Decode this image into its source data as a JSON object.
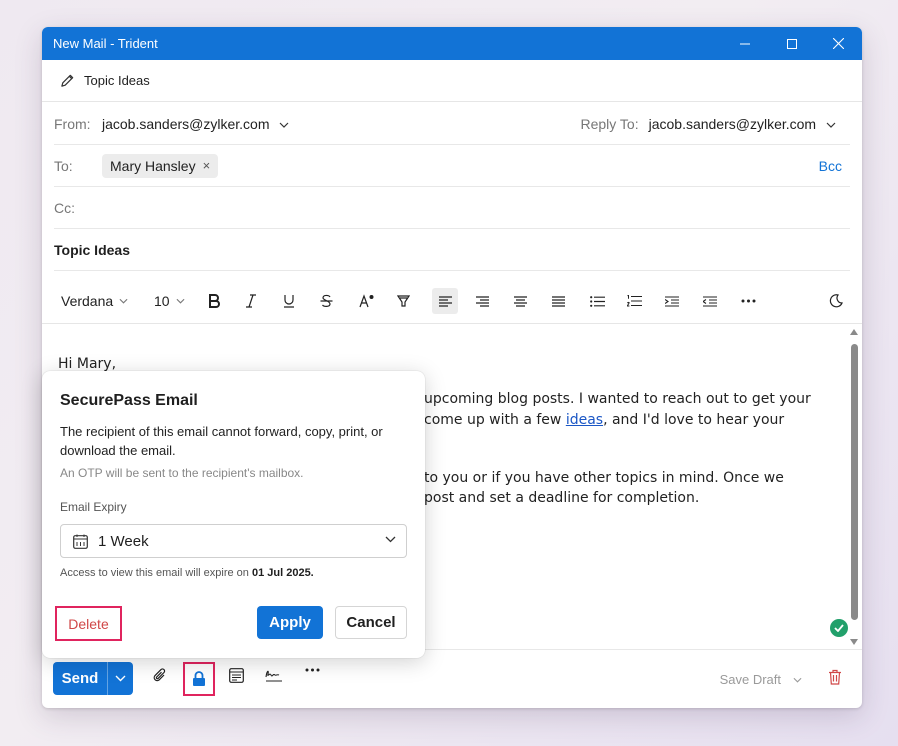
{
  "window": {
    "title": "New Mail - Trident",
    "controls": [
      "minimize-icon",
      "maximize-icon",
      "close-icon"
    ]
  },
  "subject_bar": {
    "icon": "pencil-icon",
    "title": "Topic Ideas"
  },
  "from": {
    "label": "From:",
    "value": "jacob.sanders@zylker.com"
  },
  "reply_to": {
    "label": "Reply To:",
    "value": "jacob.sanders@zylker.com"
  },
  "to": {
    "label": "To:",
    "recipients": [
      {
        "name": "Mary Hansley",
        "remove_icon": "×"
      }
    ],
    "bcc_label": "Bcc"
  },
  "cc": {
    "label": "Cc:"
  },
  "subject": {
    "value": "Topic Ideas"
  },
  "format_toolbar": {
    "font": "Verdana",
    "size": "10",
    "buttons": [
      "bold-icon",
      "italic-icon",
      "underline-icon",
      "strikethrough-icon",
      "font-color-icon",
      "highlight-icon",
      "align-left-icon",
      "align-center-icon",
      "align-right-icon",
      "justify-icon",
      "bulleted-list-icon",
      "numbered-list-icon",
      "indent-icon",
      "outdent-icon",
      "more-icon",
      "dark-mode-icon"
    ],
    "active": "align-left-icon"
  },
  "body": {
    "greeting": "Hi Mary,",
    "line1_start": "upcoming blog posts. I wanted to reach out to get your",
    "line2_pre": "come up with a few ",
    "line2_link": "ideas",
    "line2_post": ", and I'd love to hear your",
    "line3": "to you or if you have other topics in mind. Once we",
    "line4": "post and set a deadline for completion."
  },
  "bottom_bar": {
    "send_label": "Send",
    "save_draft_label": "Save Draft",
    "icons": [
      "attachment-icon",
      "lock-icon",
      "template-icon",
      "signature-icon",
      "more-icon",
      "trash-icon"
    ]
  },
  "securepass": {
    "title": "SecurePass Email",
    "description": "The recipient of this email cannot forward, copy, print, or download the email.",
    "otp_note": "An OTP will be sent to the recipient's mailbox.",
    "expiry_label": "Email Expiry",
    "expiry_value": "1 Week",
    "access_prefix": "Access to view this email will expire on ",
    "access_date": "01 Jul 2025.",
    "delete_label": "Delete",
    "apply_label": "Apply",
    "cancel_label": "Cancel"
  },
  "colors": {
    "accent": "#1273d6",
    "highlight_box": "#e0245e",
    "delete_text": "#d04747",
    "status_ok": "#22a06b"
  }
}
